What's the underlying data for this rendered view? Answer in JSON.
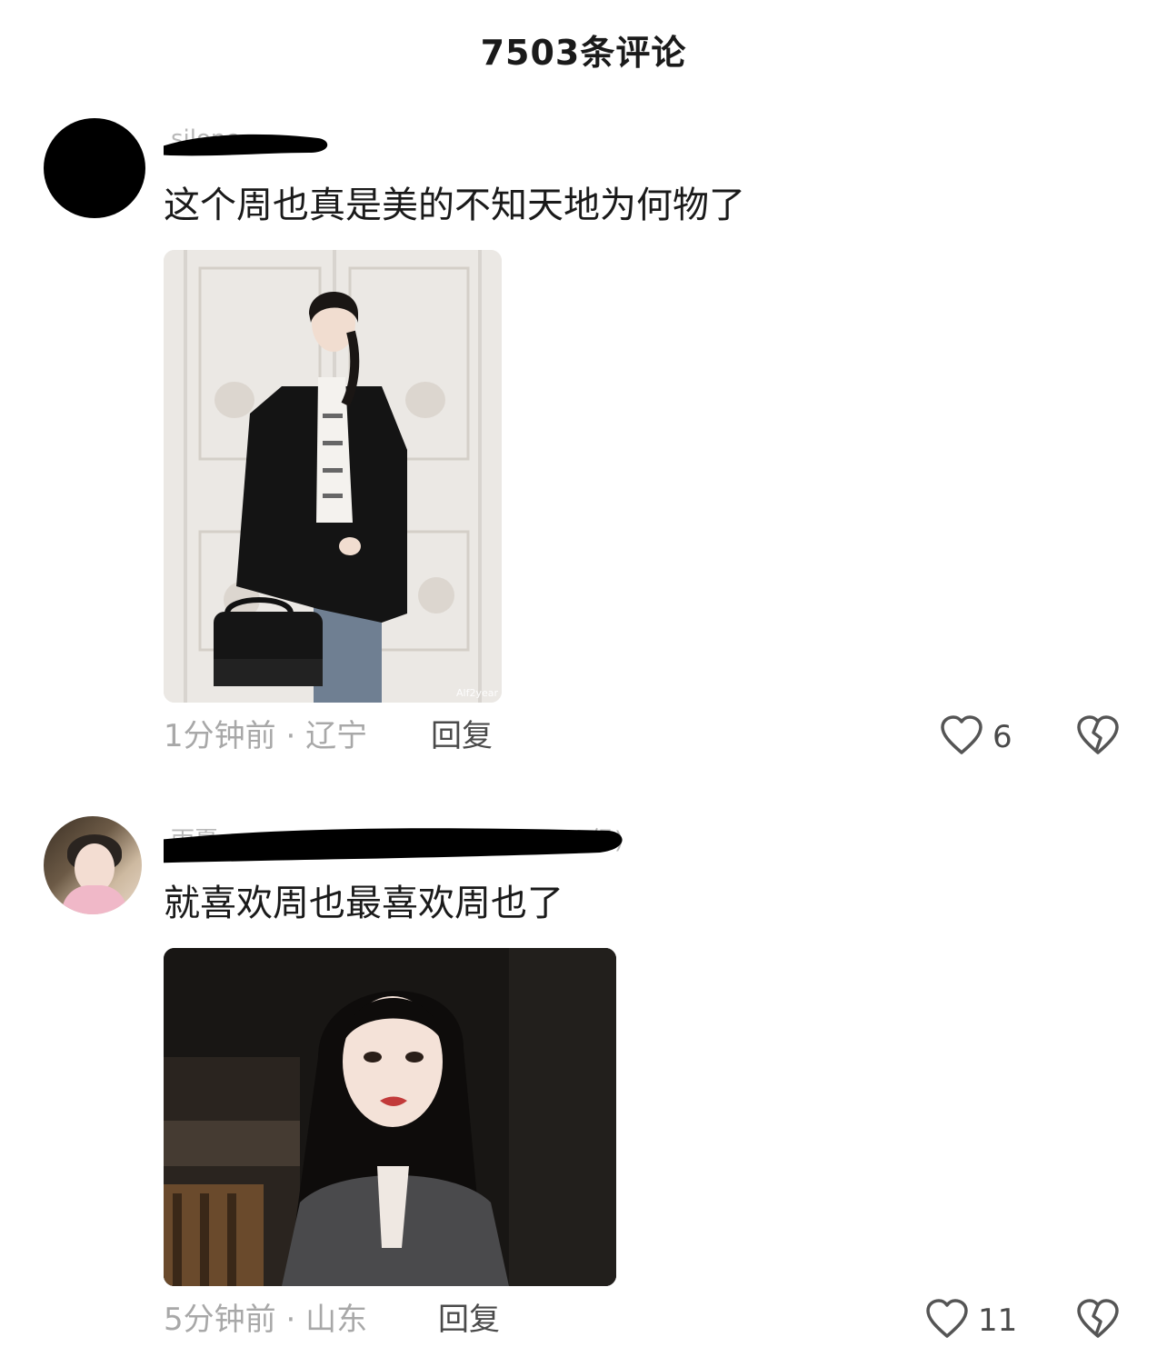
{
  "header": {
    "title": "7503条评论"
  },
  "comments": [
    {
      "username_partial": "silone",
      "text": "这个周也真是美的不知天地为何物了",
      "time": "1分钟前",
      "location": "辽宁",
      "reply_label": "回复",
      "likes": "6",
      "photo_watermark": "Alf2year"
    },
    {
      "username_partial": "雨夏",
      "username_suffix": "级)",
      "text": "就喜欢周也最喜欢周也了",
      "time": "5分钟前",
      "location": "山东",
      "reply_label": "回复",
      "likes": "11"
    }
  ],
  "meta_separator": " · ",
  "icons": {
    "like": "heart-outline-icon",
    "dislike": "broken-heart-icon"
  },
  "colors": {
    "text_primary": "#1a1a1a",
    "text_meta": "#a8a8a8",
    "text_action": "#4a4a4a",
    "background": "#ffffff"
  }
}
